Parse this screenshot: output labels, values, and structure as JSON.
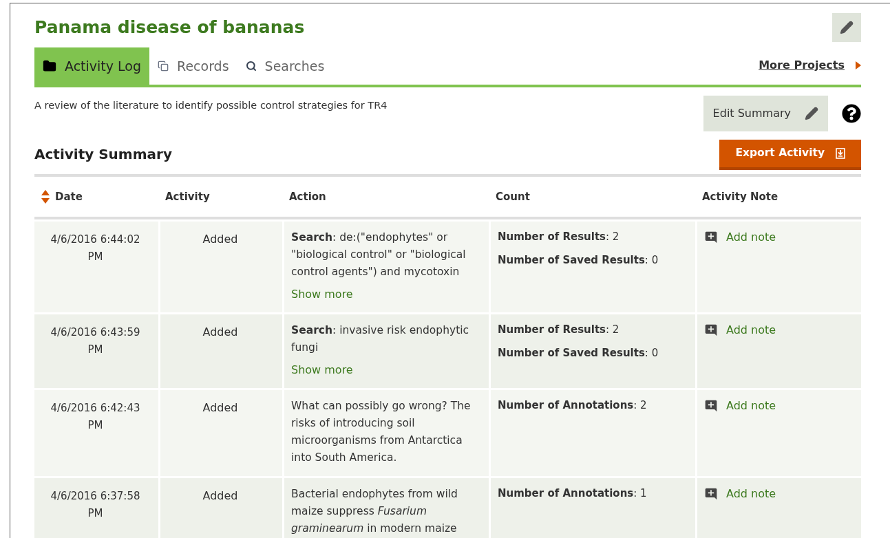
{
  "title": "Panama disease of bananas",
  "tabs": [
    {
      "label": "Activity Log",
      "kind": "folder",
      "selected": true
    },
    {
      "label": "Records",
      "kind": "copy",
      "selected": false
    },
    {
      "label": "Searches",
      "kind": "search",
      "selected": false
    }
  ],
  "more_projects": "More Projects",
  "summary": "A review of the literature to identify possible control strategies for TR4",
  "edit_summary": "Edit Summary",
  "section_title": "Activity Summary",
  "export_button": "Export Activity",
  "table": {
    "columns": [
      {
        "label": "Date",
        "sortable": true
      },
      {
        "label": "Activity",
        "sortable": false
      },
      {
        "label": "Action",
        "sortable": false
      },
      {
        "label": "Count",
        "sortable": false
      },
      {
        "label": "Activity Note",
        "sortable": false
      }
    ],
    "rows": [
      {
        "date": "4/6/2016 6:44:02 PM",
        "activity": "Added",
        "action": "**Search**: de:(\"endophytes\" or \"biological control\" or \"biological control agents\") and mycotoxin",
        "show_more": "Show more",
        "counts": [
          "**Number of Results**: 2",
          "**Number of Saved Results**: 0"
        ],
        "note": "Add note"
      },
      {
        "date": "4/6/2016 6:43:59 PM",
        "activity": "Added",
        "action": "**Search**: invasive risk endophytic fungi",
        "show_more": "Show more",
        "counts": [
          "**Number of Results**: 2",
          "**Number of Saved Results**: 0"
        ],
        "note": "Add note"
      },
      {
        "date": "4/6/2016 6:42:43 PM",
        "activity": "Added",
        "action": "What can possibly go wrong? The risks of introducing soil microorganisms from Antarctica into South America.",
        "counts": [
          "**Number of Annotations**: 2"
        ],
        "note": "Add note"
      },
      {
        "date": "4/6/2016 6:37:58 PM",
        "activity": "Added",
        "action": "Bacterial endophytes from wild maize suppress *Fusarium graminearum* in modern maize",
        "counts": [
          "**Number of Annotations**: 1"
        ],
        "note": "Add note"
      }
    ]
  }
}
